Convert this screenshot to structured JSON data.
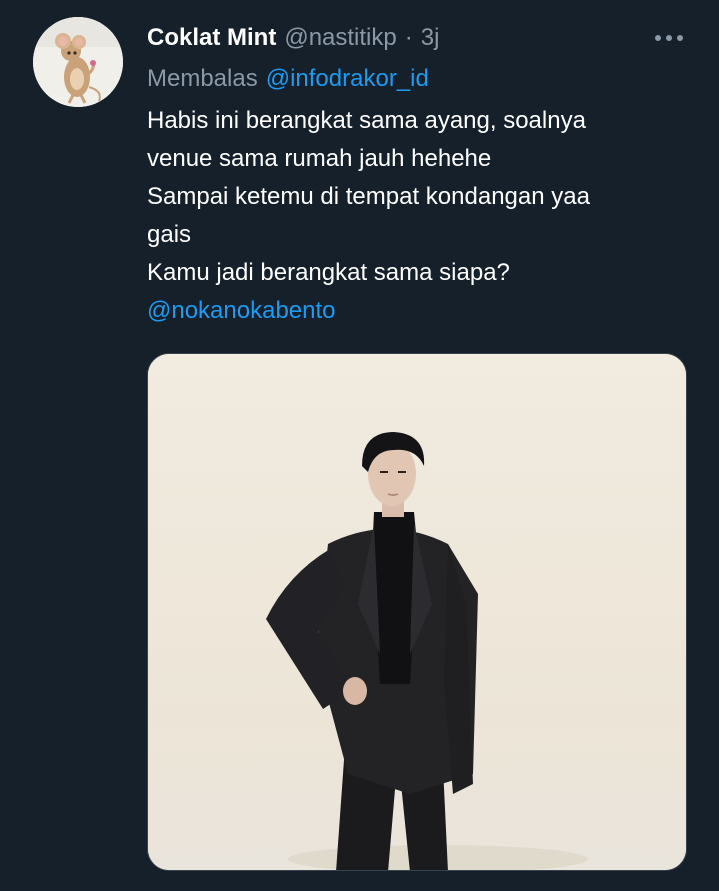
{
  "tweet": {
    "display_name": "Coklat Mint",
    "handle": "@nastitikp",
    "separator": "·",
    "time": "3j",
    "reply_prefix": "Membalas",
    "reply_to": "@infodrakor_id",
    "text_lines": [
      "Habis ini berangkat sama ayang, soalnya",
      "venue sama rumah jauh hehehe",
      "Sampai ketemu di tempat kondangan yaa",
      "gais",
      "Kamu jadi berangkat sama siapa?"
    ],
    "mention": "@nokanokabento"
  },
  "icons": {
    "more": "more-horizontal-icon"
  },
  "colors": {
    "background": "#15202b",
    "primary_text": "#ffffff",
    "secondary_text": "#8b98a5",
    "link": "#1d9bf0",
    "border": "#38444d"
  }
}
